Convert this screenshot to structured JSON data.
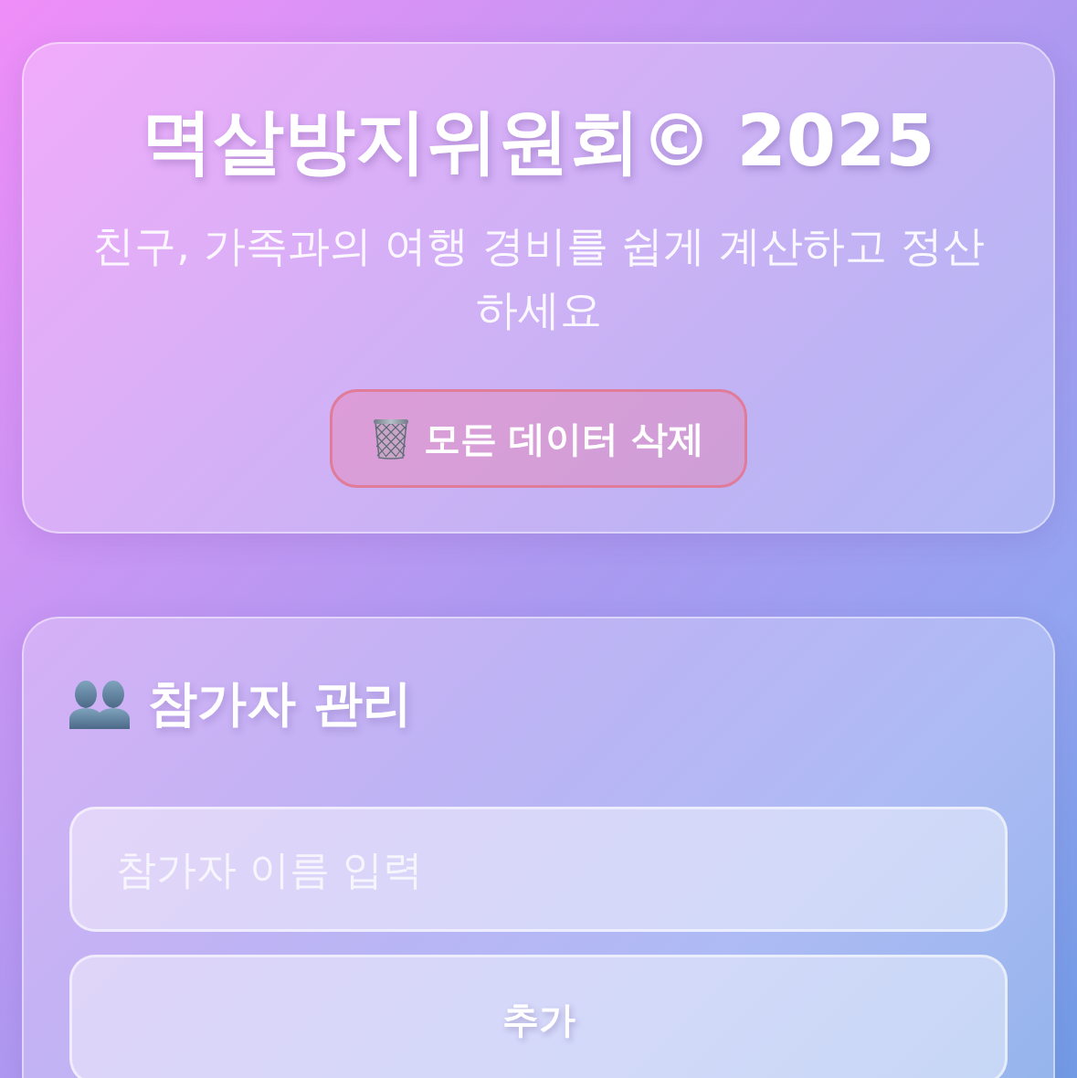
{
  "header": {
    "title": "멱살방지위원회© 2025",
    "subtitle": "친구, 가족과의 여행 경비를 쉽게 계산하고 정산하세요",
    "reset_button": {
      "label": "모든 데이터 삭제"
    }
  },
  "participants": {
    "heading": "참가자 관리",
    "name_input": {
      "placeholder": "참가자 이름 입력"
    },
    "add_button": {
      "label": "추가"
    }
  }
}
